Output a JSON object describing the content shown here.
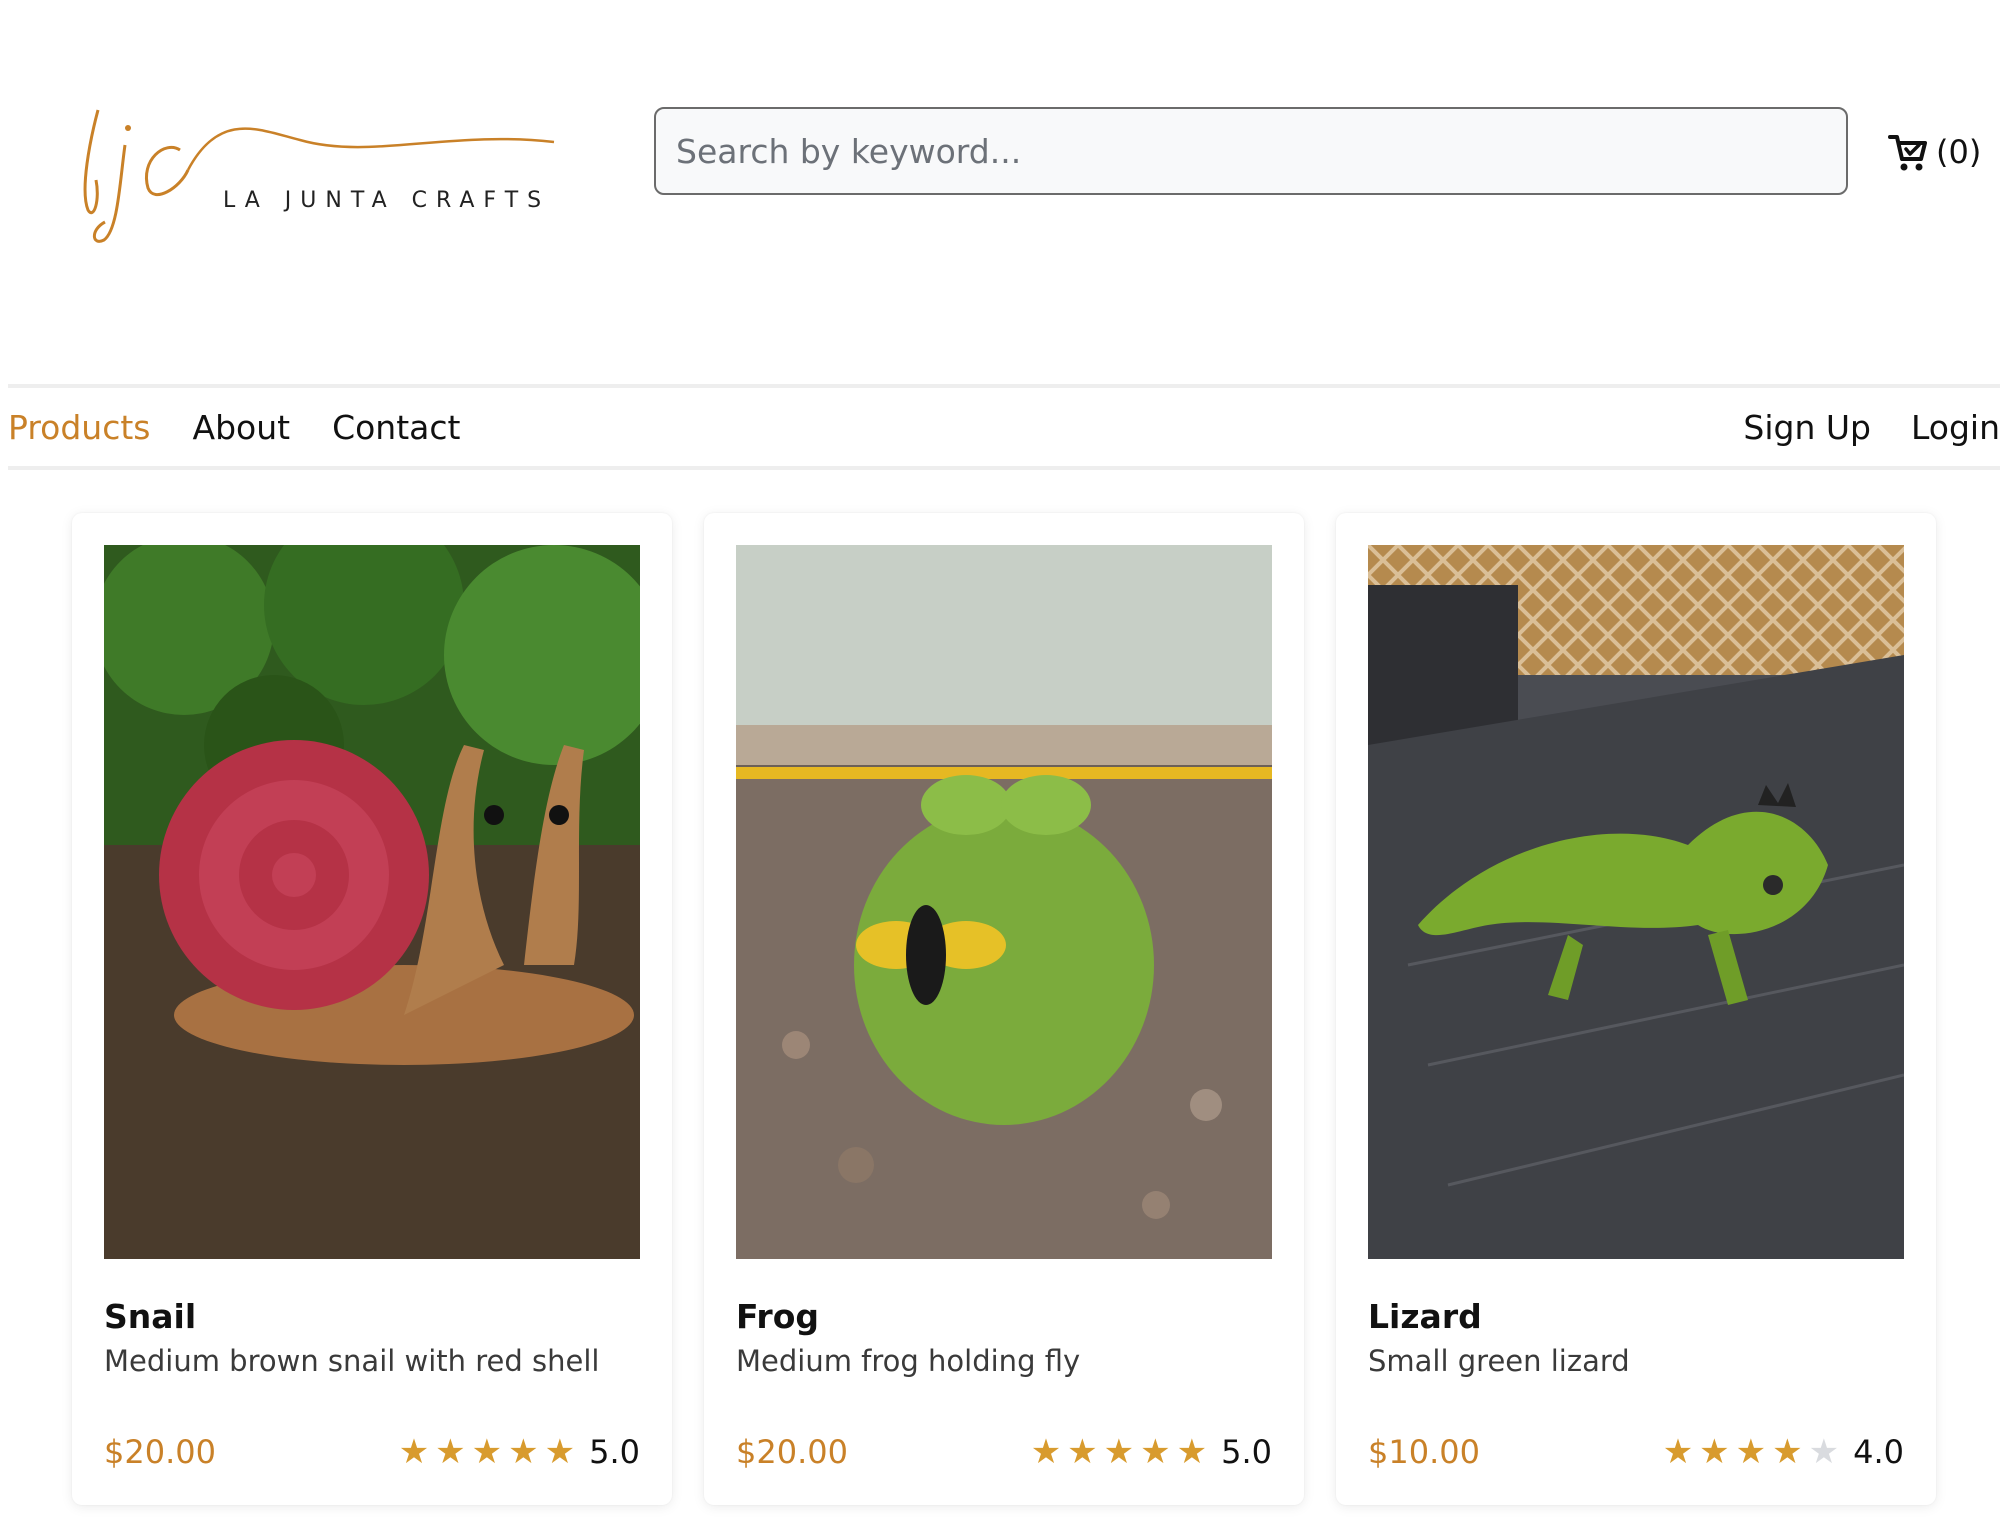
{
  "brand": {
    "monogram": "ljc",
    "name": "LA JUNTA CRAFTS",
    "color": "#c98128"
  },
  "search": {
    "placeholder": "Search by keyword...",
    "value": ""
  },
  "cart": {
    "icon": "shopping-cart-icon",
    "count_label": "(0)"
  },
  "nav": {
    "left": [
      {
        "label": "Products",
        "active": true
      },
      {
        "label": "About",
        "active": false
      },
      {
        "label": "Contact",
        "active": false
      }
    ],
    "right": [
      {
        "label": "Sign Up"
      },
      {
        "label": "Login"
      }
    ]
  },
  "products": [
    {
      "name": "Snail",
      "description": "Medium brown snail with red shell",
      "price": "$20.00",
      "rating": 5,
      "rating_label": "5.0",
      "photo": "snail-photo"
    },
    {
      "name": "Frog",
      "description": "Medium frog holding fly",
      "price": "$20.00",
      "rating": 5,
      "rating_label": "5.0",
      "photo": "frog-photo"
    },
    {
      "name": "Lizard",
      "description": "Small green lizard",
      "price": "$10.00",
      "rating": 4,
      "rating_label": "4.0",
      "photo": "lizard-photo"
    }
  ],
  "colors": {
    "accent": "#c98128",
    "star_on": "#d89b2e",
    "star_off": "#d9dbdf"
  }
}
